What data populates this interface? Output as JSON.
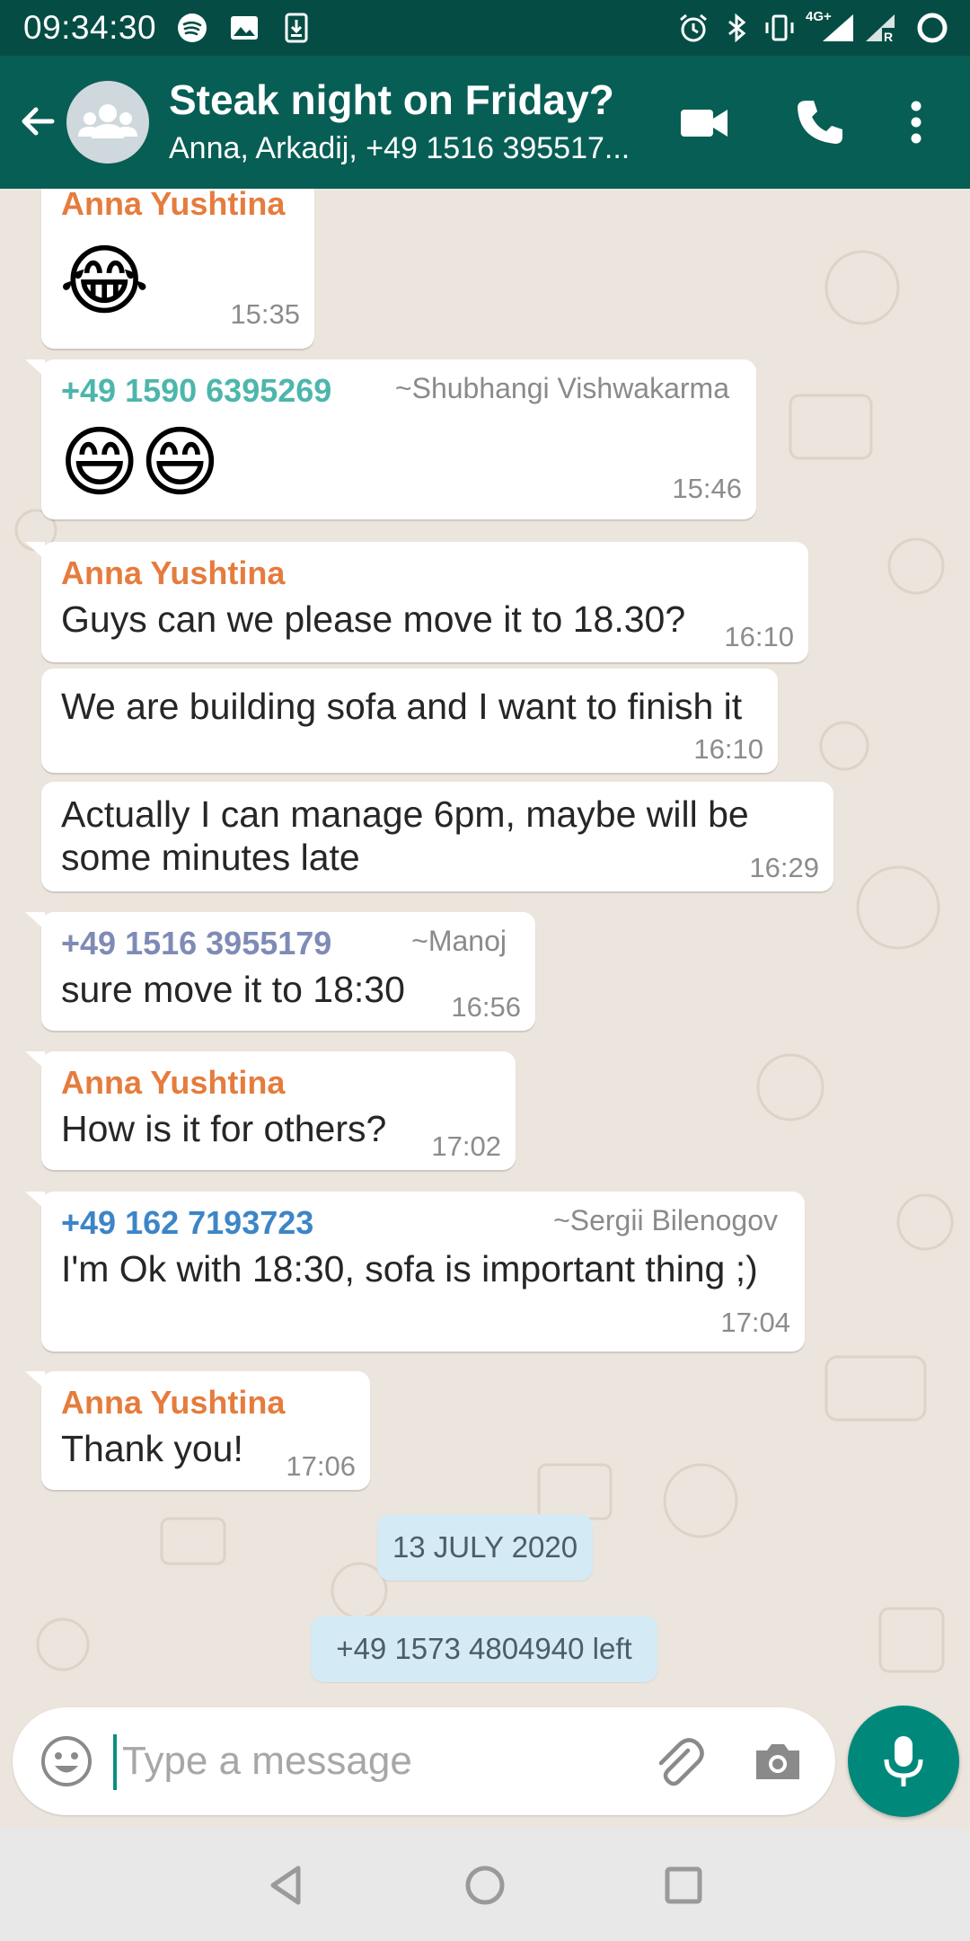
{
  "status_bar": {
    "time": "09:34:30",
    "network_label": "4G+",
    "icons": [
      "spotify-icon",
      "image-icon",
      "download-icon",
      "alarm-icon",
      "bluetooth-icon",
      "vibrate-icon",
      "signal-icon",
      "signal-roaming-icon",
      "circle-icon"
    ]
  },
  "header": {
    "title": "Steak night on Friday?",
    "subtitle": "Anna, Arkadij, +49 1516 395517...",
    "icons": [
      "back-arrow-icon",
      "group-avatar-icon",
      "video-call-icon",
      "voice-call-icon",
      "more-options-icon"
    ]
  },
  "messages": [
    {
      "sender": "Anna Yushtina",
      "emoji": "😂",
      "time": "15:35"
    },
    {
      "sender": "+49 1590 6395269",
      "alias": "~Shubhangi Vishwakarma",
      "emoji": "😄😄",
      "time": "15:46"
    },
    {
      "sender": "Anna Yushtina",
      "text": "Guys can we please move it to 18.30?",
      "time": "16:10"
    },
    {
      "text": "We are building sofa and I want to finish it",
      "time": "16:10"
    },
    {
      "text_line1": "Actually I can manage 6pm, maybe will be",
      "text_line2": "some minutes late",
      "time": "16:29"
    },
    {
      "sender": "+49 1516 3955179",
      "alias": "~Manoj",
      "text": "sure move it to 18:30",
      "time": "16:56"
    },
    {
      "sender": "Anna Yushtina",
      "text": "How is it for others?",
      "time": "17:02"
    },
    {
      "sender": "+49 162 7193723",
      "alias": "~Sergii Bilenogov",
      "text": "I'm Ok with 18:30, sofa is important thing ;)",
      "time": "17:04"
    },
    {
      "sender": "Anna Yushtina",
      "text": "Thank you!",
      "time": "17:06"
    }
  ],
  "date_chip": "13 JULY 2020",
  "system_message": "+49 1573 4804940 left",
  "composer": {
    "placeholder": "Type a message",
    "icons": [
      "emoji-icon",
      "attach-icon",
      "camera-icon",
      "microphone-icon"
    ]
  },
  "navigation": {
    "icons": [
      "back-triangle-icon",
      "home-circle-icon",
      "recents-square-icon"
    ]
  },
  "colors": {
    "header": "#075e54",
    "status_bar": "#054d44",
    "chat_background": "#ece5dd",
    "accent": "#00897b",
    "sender_anna": "#e57c3d",
    "sender_shubhangi": "#4db6ac",
    "sender_manoj": "#7f8bb6",
    "sender_sergii": "#3d85c6",
    "date_chip": "#d4eaf4"
  }
}
